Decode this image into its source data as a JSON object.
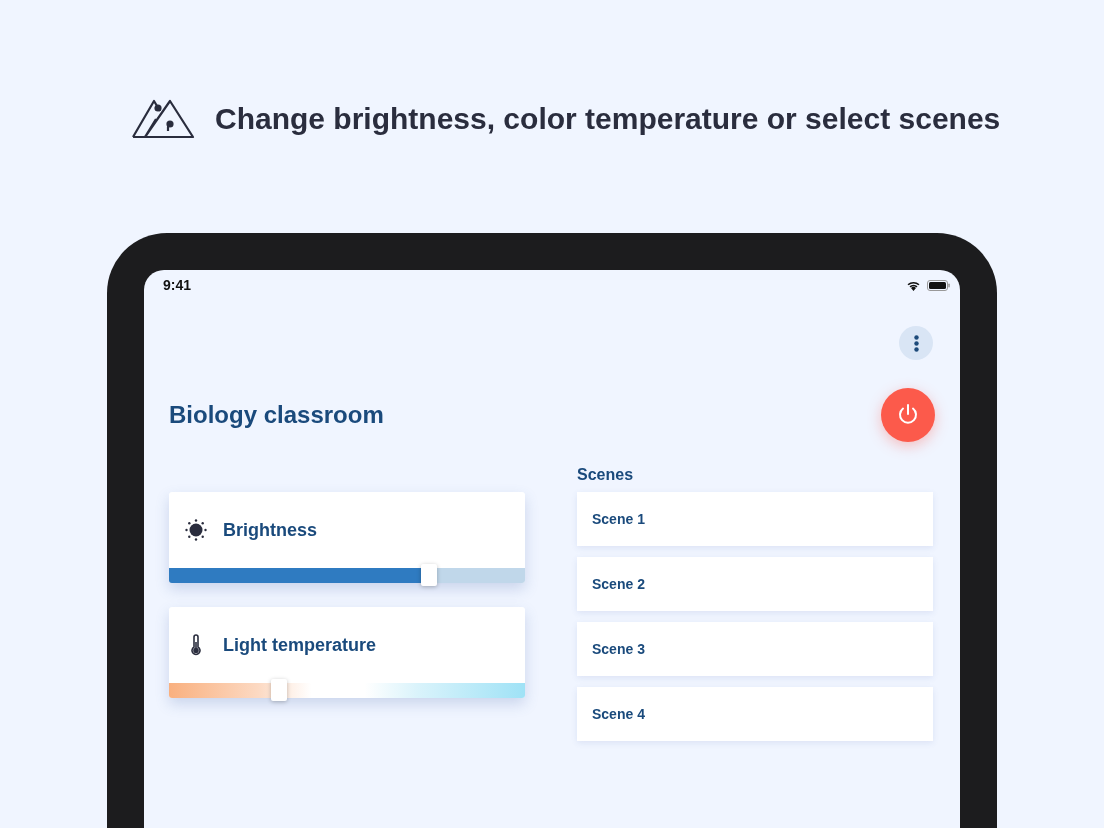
{
  "headline": "Change brightness, color temperature or select scenes",
  "status_bar": {
    "time": "9:41"
  },
  "room": {
    "title": "Biology classroom",
    "power_on": true
  },
  "controls": [
    {
      "kind": "brightness",
      "label": "Brightness",
      "level": 0.73
    },
    {
      "kind": "temperature",
      "label": "Light temperature",
      "level": 0.31
    }
  ],
  "scenes": {
    "title": "Scenes",
    "items": [
      {
        "label": "Scene 1"
      },
      {
        "label": "Scene 2"
      },
      {
        "label": "Scene 3"
      },
      {
        "label": "Scene 4"
      }
    ]
  }
}
